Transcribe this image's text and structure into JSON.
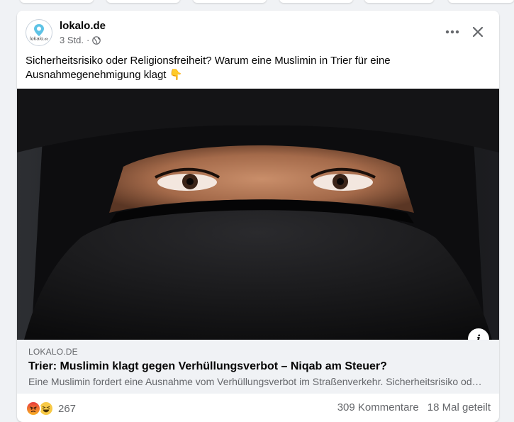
{
  "post": {
    "page_name": "lokalo.de",
    "avatar_text": "lokalo.de",
    "time": "3 Std.",
    "separator": "·",
    "text": "Sicherheitsrisiko oder Religionsfreiheit?  Warum eine Muslimin in Trier für eine Ausnahmegenehmigung klagt 👇"
  },
  "link_preview": {
    "domain": "LOKALO.DE",
    "title": "Trier: Muslimin klagt gegen Verhüllungsverbot – Niqab am Steuer?",
    "description": "Eine Muslimin fordert eine Ausnahme vom Verhüllungsverbot im Straßenverkehr. Sicherheitsrisiko oder Religionsfreiheit?"
  },
  "engagement": {
    "reaction_count": "267",
    "comments": "309 Kommentare",
    "shares": "18 Mal geteilt"
  },
  "icons": {
    "more": "more-options-icon",
    "close": "close-icon",
    "info": "info-icon",
    "audience": "globe-icon"
  },
  "colors": {
    "background": "#f0f2f5",
    "card": "#ffffff",
    "secondary_text": "#65676b",
    "primary_text": "#050505"
  }
}
